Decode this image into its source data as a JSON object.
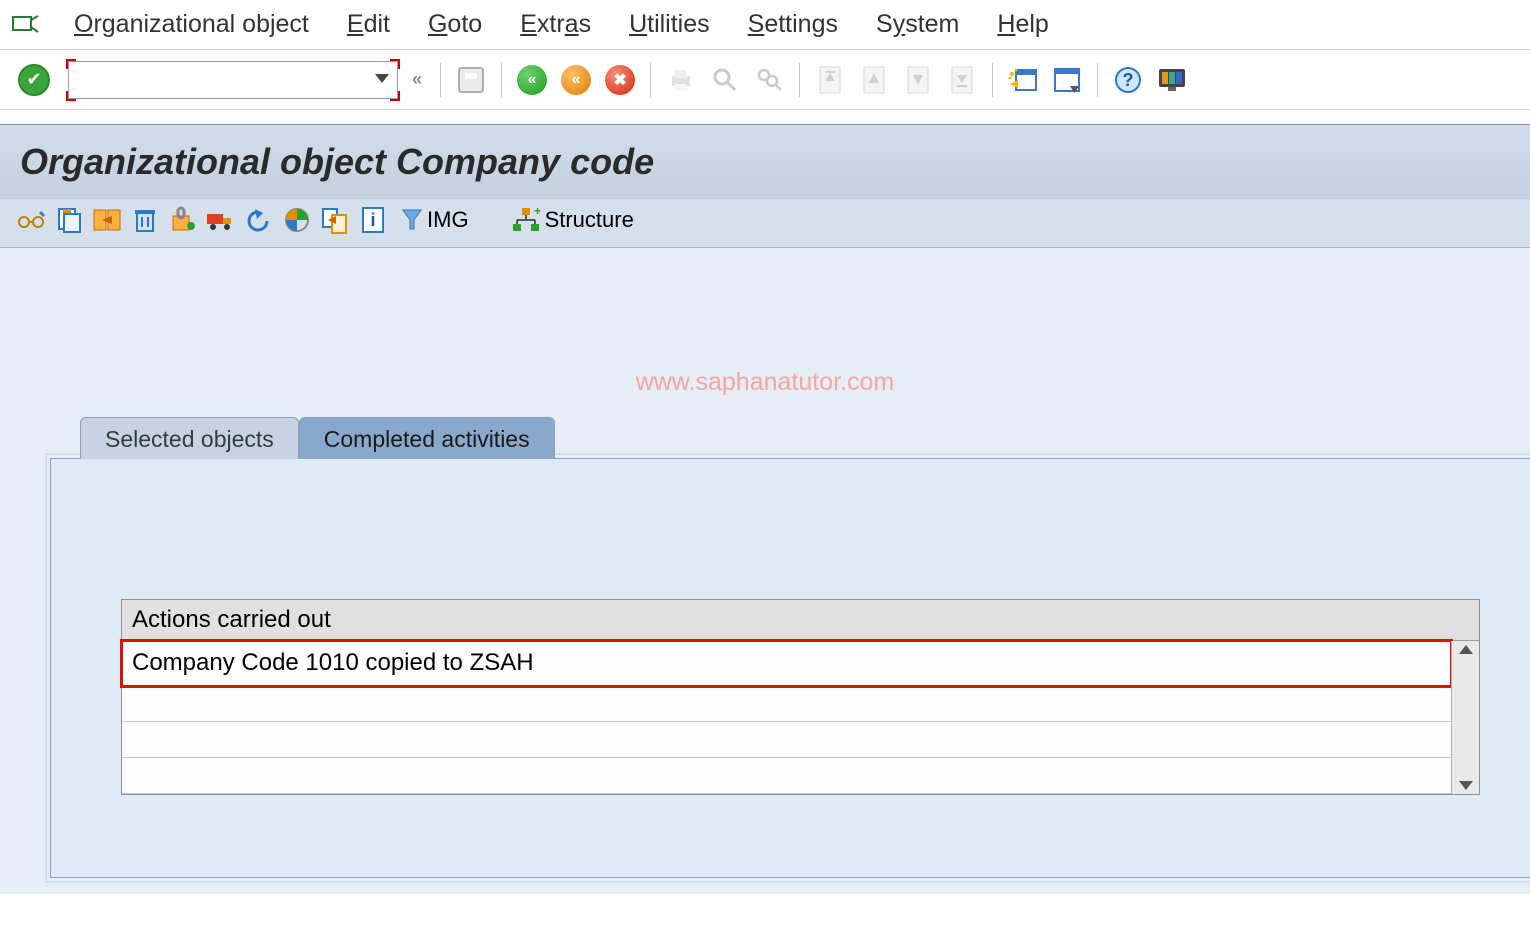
{
  "menu": {
    "items": [
      {
        "pre": "O",
        "label": "rganizational object"
      },
      {
        "pre": "E",
        "label": "dit"
      },
      {
        "pre": "G",
        "label": "oto"
      },
      {
        "pre": "E",
        "plain": "xtr",
        "mid": "a",
        "post": "s"
      },
      {
        "pre": "U",
        "label": "tilities"
      },
      {
        "pre": "S",
        "label": "ettings"
      },
      {
        "pre": "",
        "plain": "S",
        "mid": "y",
        "post": "stem"
      },
      {
        "pre": "H",
        "label": "elp"
      }
    ]
  },
  "tcode_value": "",
  "title": "Organizational object Company code",
  "app_toolbar": {
    "img_label": "IMG",
    "structure_label": "Structure"
  },
  "watermark": "www.saphanatutor.com",
  "tabs": {
    "selected": "Selected objects",
    "completed": "Completed activities"
  },
  "grid": {
    "header": "Actions carried out",
    "rows": [
      "Company Code 1010 copied to ZSAH"
    ]
  }
}
